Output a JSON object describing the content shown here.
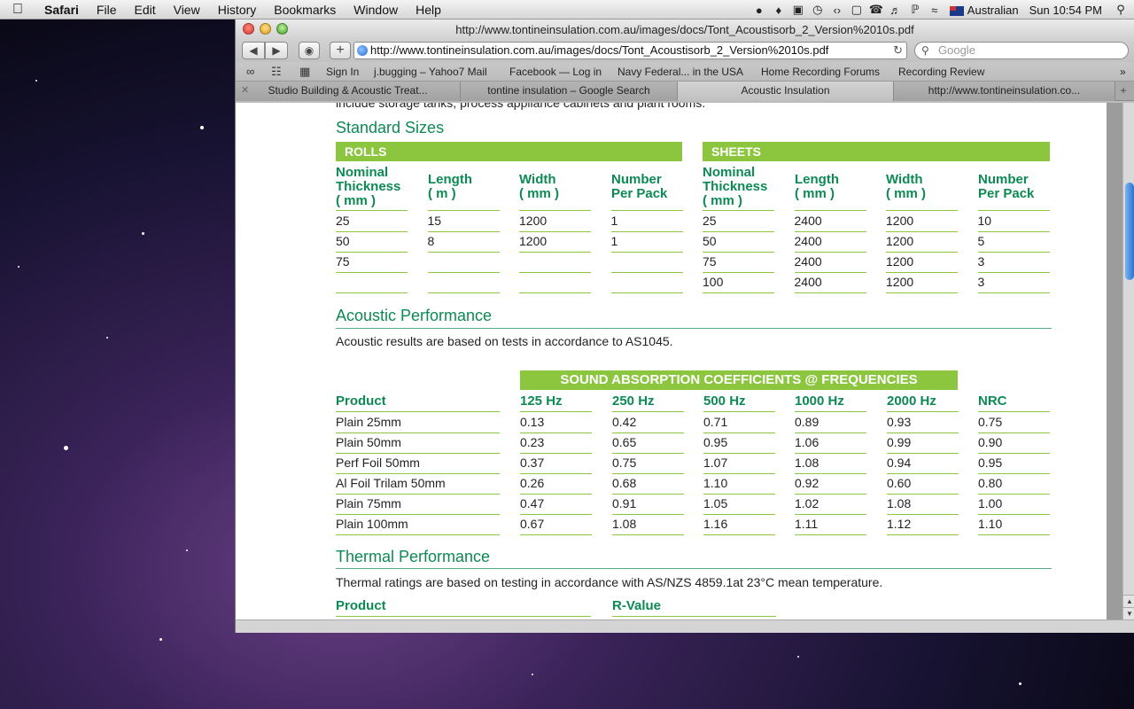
{
  "menubar": {
    "app": "Safari",
    "items": [
      "File",
      "Edit",
      "View",
      "History",
      "Bookmarks",
      "Window",
      "Help"
    ],
    "keyboard_layout": "Australian",
    "clock": "Sun 10:54 PM"
  },
  "window": {
    "title": "http://www.tontineinsulation.com.au/images/docs/Tont_Acoustisorb_2_Version%2010s.pdf",
    "url": "http://www.tontineinsulation.com.au/images/docs/Tont_Acoustisorb_2_Version%2010s.pdf",
    "search_placeholder": "Google",
    "bookmarks": [
      "Sign In",
      "j.bugging – Yahoo7 Mail",
      "Facebook — Log in",
      "Navy Federal... in the USA",
      "Home Recording Forums",
      "Recording Review"
    ],
    "tabs": [
      "Studio Building & Acoustic Treat...",
      "tontine insulation – Google Search",
      "Acoustic Insulation",
      "http://www.tontineinsulation.co..."
    ],
    "active_tab": 2
  },
  "doc": {
    "cutoff_text": "include storage tanks, process appliance cabinets and plant rooms.",
    "standard_sizes_heading": "Standard Sizes",
    "rolls": {
      "label": "ROLLS",
      "headers": [
        "Nominal Thickness ( mm )",
        "Length ( m )",
        "Width ( mm )",
        "Number Per Pack"
      ],
      "rows": [
        [
          "25",
          "15",
          "1200",
          "1"
        ],
        [
          "50",
          "8",
          "1200",
          "1"
        ],
        [
          "75",
          "",
          "",
          ""
        ],
        [
          "",
          "",
          "",
          ""
        ]
      ]
    },
    "sheets": {
      "label": "SHEETS",
      "headers": [
        "Nominal Thickness ( mm )",
        "Length ( mm )",
        "Width ( mm )",
        "Number Per Pack"
      ],
      "rows": [
        [
          "25",
          "2400",
          "1200",
          "10"
        ],
        [
          "50",
          "2400",
          "1200",
          "5"
        ],
        [
          "75",
          "2400",
          "1200",
          "3"
        ],
        [
          "100",
          "2400",
          "1200",
          "3"
        ]
      ]
    },
    "acoustic_heading": "Acoustic Performance",
    "acoustic_text": "Acoustic results are based on tests in accordance to AS1045.",
    "absorption_bar": "SOUND ABSORPTION COEFFICIENTS @ FREQUENCIES",
    "absorption_headers": [
      "Product",
      "125 Hz",
      "250 Hz",
      "500 Hz",
      "1000 Hz",
      "2000 Hz",
      "NRC"
    ],
    "absorption_rows": [
      [
        "Plain 25mm",
        "0.13",
        "0.42",
        "0.71",
        "0.89",
        "0.93",
        "0.75"
      ],
      [
        "Plain 50mm",
        "0.23",
        "0.65",
        "0.95",
        "1.06",
        "0.99",
        "0.90"
      ],
      [
        "Perf Foil 50mm",
        "0.37",
        "0.75",
        "1.07",
        "1.08",
        "0.94",
        "0.95"
      ],
      [
        "Al Foil Trilam 50mm",
        "0.26",
        "0.68",
        "1.10",
        "0.92",
        "0.60",
        "0.80"
      ],
      [
        "Plain 75mm",
        "0.47",
        "0.91",
        "1.05",
        "1.02",
        "1.08",
        "1.00"
      ],
      [
        "Plain 100mm",
        "0.67",
        "1.08",
        "1.16",
        "1.11",
        "1.12",
        "1.10"
      ]
    ],
    "thermal_heading": "Thermal Performance",
    "thermal_text": "Thermal ratings are based on testing in accordance with AS/NZS 4859.1at 23°C mean temperature.",
    "thermal_headers": [
      "Product",
      "R-Value"
    ]
  },
  "colors": {
    "heading_green": "#0d8a54",
    "bar_green": "#8cc63f"
  }
}
